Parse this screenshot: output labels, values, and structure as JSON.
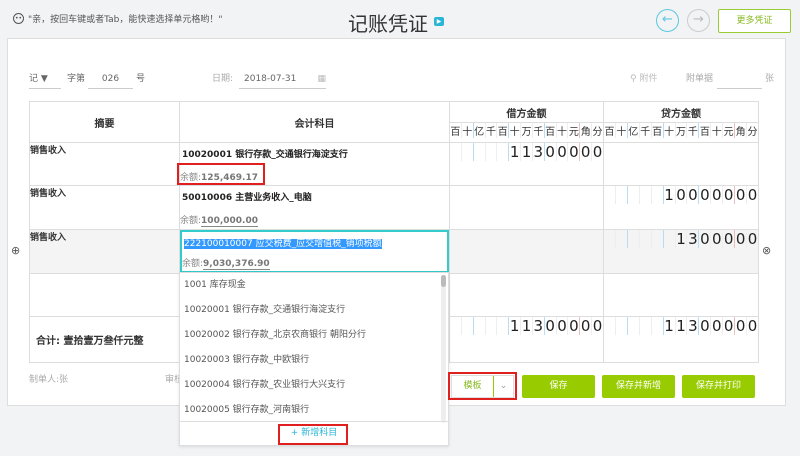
{
  "header": {
    "tip": "\"亲，按回车键或者Tab，能快速选择单元格哟！\"",
    "title": "记账凭证",
    "more_label": "更多凭证",
    "prev_icon": "arrow-left",
    "next_icon": "arrow-right"
  },
  "form": {
    "type": "记",
    "zi_label": "字第",
    "number": "026",
    "hao_label": "号",
    "date_label": "日期:",
    "date": "2018-07-31",
    "attach_label": "附件",
    "attach_docs_label": "附单据",
    "attach_count": "",
    "zhang_label": "张"
  },
  "table": {
    "headers": {
      "summary": "摘要",
      "account": "会计科目",
      "debit": "借方金额",
      "credit": "贷方金额"
    },
    "units": [
      "百",
      "十",
      "亿",
      "千",
      "百",
      "十",
      "万",
      "千",
      "百",
      "十",
      "元",
      "角",
      "分"
    ],
    "rows": [
      {
        "summary": "销售收入",
        "account": "10020001 银行存款_交通银行海淀支行",
        "balance_label": "余额:",
        "balance": "125,469.17",
        "debit": "11300000",
        "credit": ""
      },
      {
        "summary": "销售收入",
        "account": "50010006 主营业务收入_电脑",
        "balance_label": "余额:",
        "balance": "100,000.00",
        "debit": "",
        "credit": "10000000"
      },
      {
        "summary": "销售收入",
        "account": "222100010007   应交税费_应交增值税_销项税额",
        "balance_label": "余额:",
        "balance": "9,030,376.90",
        "debit": "",
        "credit": "1300000"
      },
      {
        "summary": "",
        "account": "",
        "balance_label": "",
        "balance": "",
        "debit": "",
        "credit": ""
      }
    ],
    "total": {
      "label": "合计:",
      "amount_words": "壹拾壹万叁仟元整",
      "debit": "11300000",
      "credit": "11300000"
    }
  },
  "footer": {
    "maker_label": "制单人:",
    "maker": "张",
    "auditor_label": "审核"
  },
  "dropdown": {
    "items": [
      "1001 库存现金",
      "10020001 银行存款_交通银行海淀支行",
      "10020002 银行存款_北京农商银行 朝阳分行",
      "10020003 银行存款_中欧银行",
      "10020004 银行存款_农业银行大兴支行",
      "10020005 银行存款_河南银行"
    ],
    "add_label": "+ 新增科目"
  },
  "actions": {
    "template": "模板",
    "save": "保存",
    "save_new": "保存并新增",
    "save_print": "保存并打印"
  },
  "colors": {
    "accent": "#99cc00",
    "highlight": "#e0201e",
    "focus": "#3cc"
  }
}
